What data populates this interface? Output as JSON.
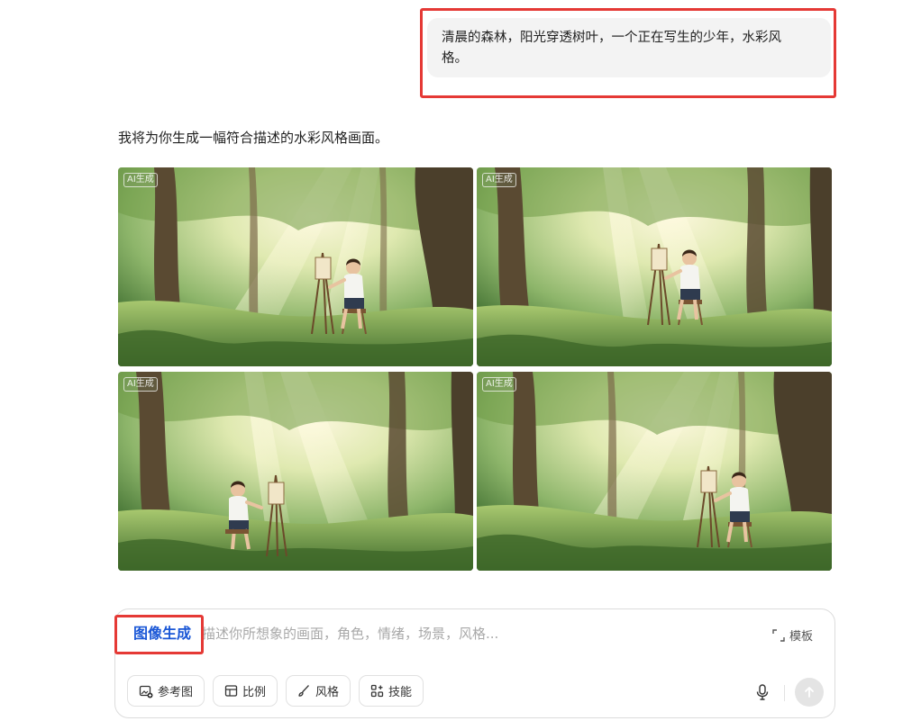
{
  "conversation": {
    "user_prompt": "清晨的森林，阳光穿透树叶，一个正在写生的少年，水彩风格。",
    "user_prompt_line1": "清晨的森林，阳光穿透树叶，一个正在写生的少年，水彩风",
    "user_prompt_line2": "格。",
    "assistant_reply": "我将为你生成一幅符合描述的水彩风格画面。",
    "generated_images": [
      {
        "badge": "AI生成",
        "alt": "森林中阳光穿透树叶，少年在画架前写生的水彩画"
      },
      {
        "badge": "AI生成",
        "alt": "森林中阳光穿透树叶，少年在画架前写生的水彩画"
      },
      {
        "badge": "AI生成",
        "alt": "森林中阳光穿透树叶，少年在画架前写生的水彩画"
      },
      {
        "badge": "AI生成",
        "alt": "森林中阳光穿透树叶，少年在画架前写生的水彩画"
      }
    ]
  },
  "composer": {
    "mode_label": "图像生成",
    "placeholder": "描述你所想象的画面，角色，情绪，场景，风格...",
    "template_label": "模板",
    "tools": [
      {
        "label": "参考图",
        "icon": "image-add-icon"
      },
      {
        "label": "比例",
        "icon": "aspect-ratio-icon"
      },
      {
        "label": "风格",
        "icon": "brush-icon"
      },
      {
        "label": "技能",
        "icon": "apps-icon"
      }
    ]
  },
  "colors": {
    "accent_blue": "#1a57d6",
    "highlight_red": "#e53935",
    "bubble_bg": "#f3f3f3"
  }
}
